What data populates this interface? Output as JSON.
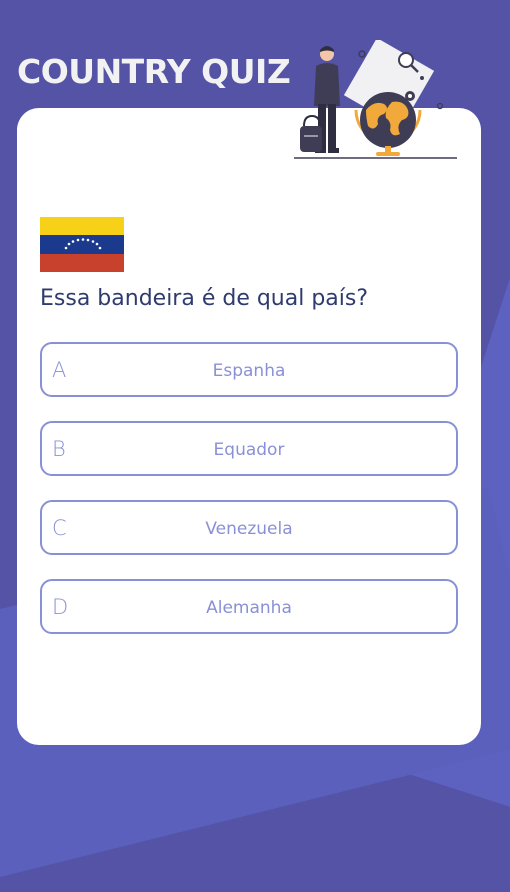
{
  "app": {
    "title": "COUNTRY QUIZ"
  },
  "quiz": {
    "question": "Essa bandeira é de qual país?",
    "flag_icon": "venezuela-flag-icon",
    "options": [
      {
        "letter": "A",
        "text": "Espanha"
      },
      {
        "letter": "B",
        "text": "Equador"
      },
      {
        "letter": "C",
        "text": "Venezuela"
      },
      {
        "letter": "D",
        "text": "Alemanha"
      }
    ]
  },
  "colors": {
    "background": "#5453a6",
    "card": "#ffffff",
    "option_border": "#8a90d6",
    "question_text": "#2f3b6e",
    "accent_globe": "#f2a93b"
  }
}
